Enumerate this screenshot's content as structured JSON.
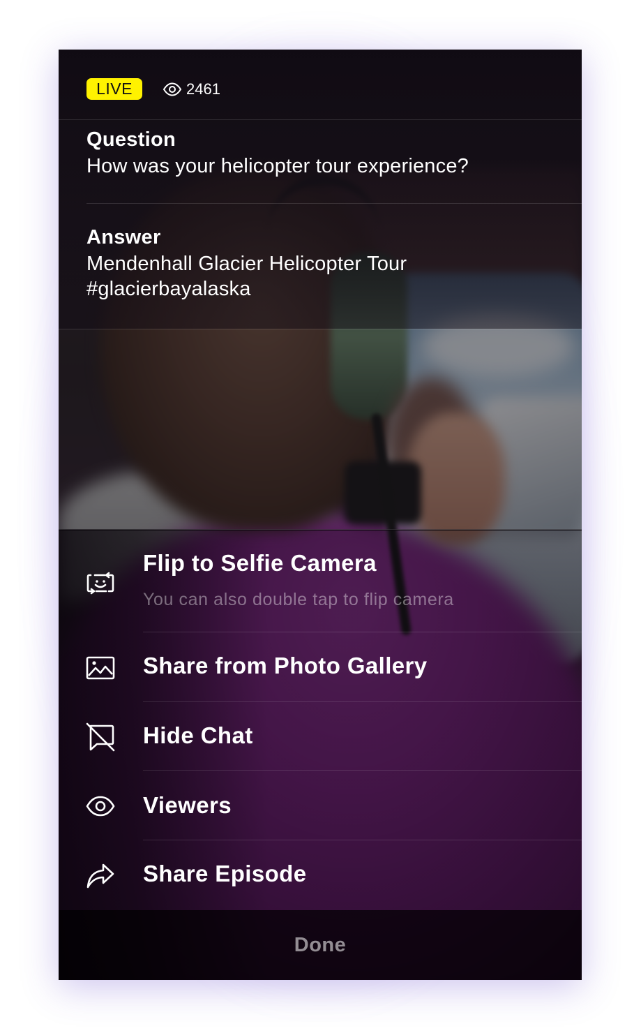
{
  "status": {
    "live_label": "LIVE",
    "viewer_count": "2461",
    "viewer_icon": "eye-icon",
    "badge_color": "#fff200"
  },
  "qa": {
    "question_label": "Question",
    "question_text": "How was your helicopter tour experience?",
    "answer_label": "Answer",
    "answer_text": "Mendenhall Glacier Helicopter Tour #glacierbayalaska"
  },
  "menu": {
    "items": [
      {
        "label": "Flip to Selfie Camera",
        "subtitle": "You can also double tap to flip camera",
        "icon": "flip-camera-icon"
      },
      {
        "label": "Share from Photo Gallery",
        "icon": "image-icon"
      },
      {
        "label": "Hide Chat",
        "icon": "chat-off-icon"
      },
      {
        "label": "Viewers",
        "icon": "eye-icon"
      },
      {
        "label": "Share Episode",
        "icon": "share-arrow-icon"
      }
    ]
  },
  "footer": {
    "done_label": "Done"
  }
}
